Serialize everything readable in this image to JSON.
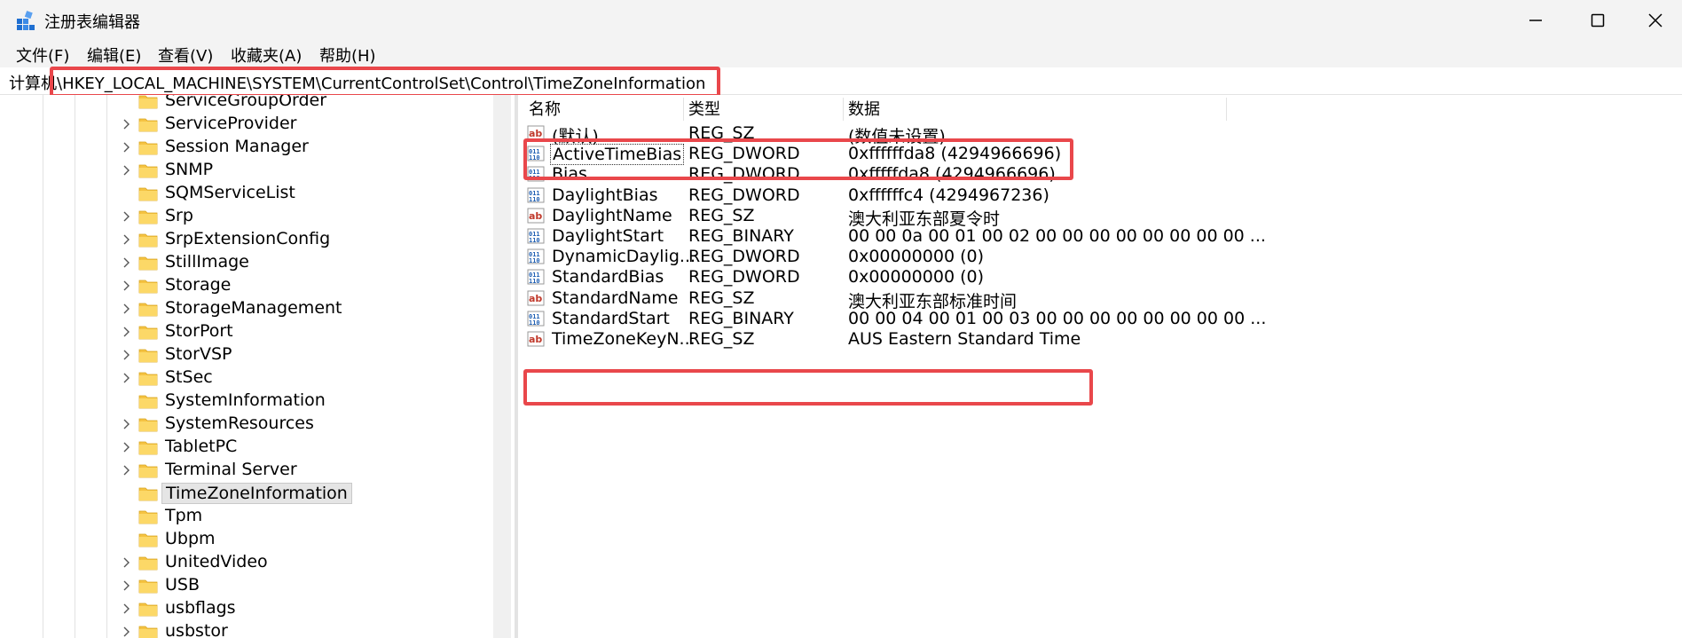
{
  "window": {
    "title": "注册表编辑器"
  },
  "menu": [
    "文件(F)",
    "编辑(E)",
    "查看(V)",
    "收藏夹(A)",
    "帮助(H)"
  ],
  "address": {
    "prefix": "计算机",
    "path": "\\HKEY_LOCAL_MACHINE\\SYSTEM\\CurrentControlSet\\Control\\TimeZoneInformation"
  },
  "tree": {
    "items": [
      {
        "label": "ServiceGroupOrder",
        "expandable": false
      },
      {
        "label": "ServiceProvider",
        "expandable": true
      },
      {
        "label": "Session Manager",
        "expandable": true
      },
      {
        "label": "SNMP",
        "expandable": true
      },
      {
        "label": "SQMServiceList",
        "expandable": false
      },
      {
        "label": "Srp",
        "expandable": true
      },
      {
        "label": "SrpExtensionConfig",
        "expandable": true
      },
      {
        "label": "StillImage",
        "expandable": true
      },
      {
        "label": "Storage",
        "expandable": true
      },
      {
        "label": "StorageManagement",
        "expandable": true
      },
      {
        "label": "StorPort",
        "expandable": true
      },
      {
        "label": "StorVSP",
        "expandable": true
      },
      {
        "label": "StSec",
        "expandable": true
      },
      {
        "label": "SystemInformation",
        "expandable": false
      },
      {
        "label": "SystemResources",
        "expandable": true
      },
      {
        "label": "TabletPC",
        "expandable": true
      },
      {
        "label": "Terminal Server",
        "expandable": true
      },
      {
        "label": "TimeZoneInformation",
        "expandable": false,
        "selected": true
      },
      {
        "label": "Tpm",
        "expandable": false
      },
      {
        "label": "Ubpm",
        "expandable": false
      },
      {
        "label": "UnitedVideo",
        "expandable": true
      },
      {
        "label": "USB",
        "expandable": true
      },
      {
        "label": "usbflags",
        "expandable": true
      },
      {
        "label": "usbstor",
        "expandable": true
      }
    ]
  },
  "values": {
    "headers": {
      "name": "名称",
      "type": "类型",
      "data": "数据"
    },
    "rows": [
      {
        "icon": "string-value-icon",
        "name": "(默认)",
        "type": "REG_SZ",
        "data": "(数值未设置)"
      },
      {
        "icon": "binary-value-icon",
        "name": "ActiveTimeBias",
        "type": "REG_DWORD",
        "data": "0xffffffda8 (4294966696)",
        "focused": true
      },
      {
        "icon": "binary-value-icon",
        "name": "Bias",
        "type": "REG_DWORD",
        "data": "0xfffffda8 (4294966696)"
      },
      {
        "icon": "binary-value-icon",
        "name": "DaylightBias",
        "type": "REG_DWORD",
        "data": "0xffffffc4 (4294967236)"
      },
      {
        "icon": "string-value-icon",
        "name": "DaylightName",
        "type": "REG_SZ",
        "data": "澳大利亚东部夏令时"
      },
      {
        "icon": "binary-value-icon",
        "name": "DaylightStart",
        "type": "REG_BINARY",
        "data": "00 00 0a 00 01 00 02 00 00 00 00 00 00 00 00 ..."
      },
      {
        "icon": "binary-value-icon",
        "name": "DynamicDaylig...",
        "type": "REG_DWORD",
        "data": "0x00000000 (0)"
      },
      {
        "icon": "binary-value-icon",
        "name": "StandardBias",
        "type": "REG_DWORD",
        "data": "0x00000000 (0)"
      },
      {
        "icon": "string-value-icon",
        "name": "StandardName",
        "type": "REG_SZ",
        "data": "澳大利亚东部标准时间"
      },
      {
        "icon": "binary-value-icon",
        "name": "StandardStart",
        "type": "REG_BINARY",
        "data": "00 00 04 00 01 00 03 00 00 00 00 00 00 00 00 ..."
      },
      {
        "icon": "string-value-icon",
        "name": "TimeZoneKeyN...",
        "type": "REG_SZ",
        "data": "AUS Eastern Standard Time"
      }
    ]
  },
  "colors": {
    "highlight": "#e9474b",
    "folder": "#f5c342",
    "selection": "#e5e5e5"
  }
}
